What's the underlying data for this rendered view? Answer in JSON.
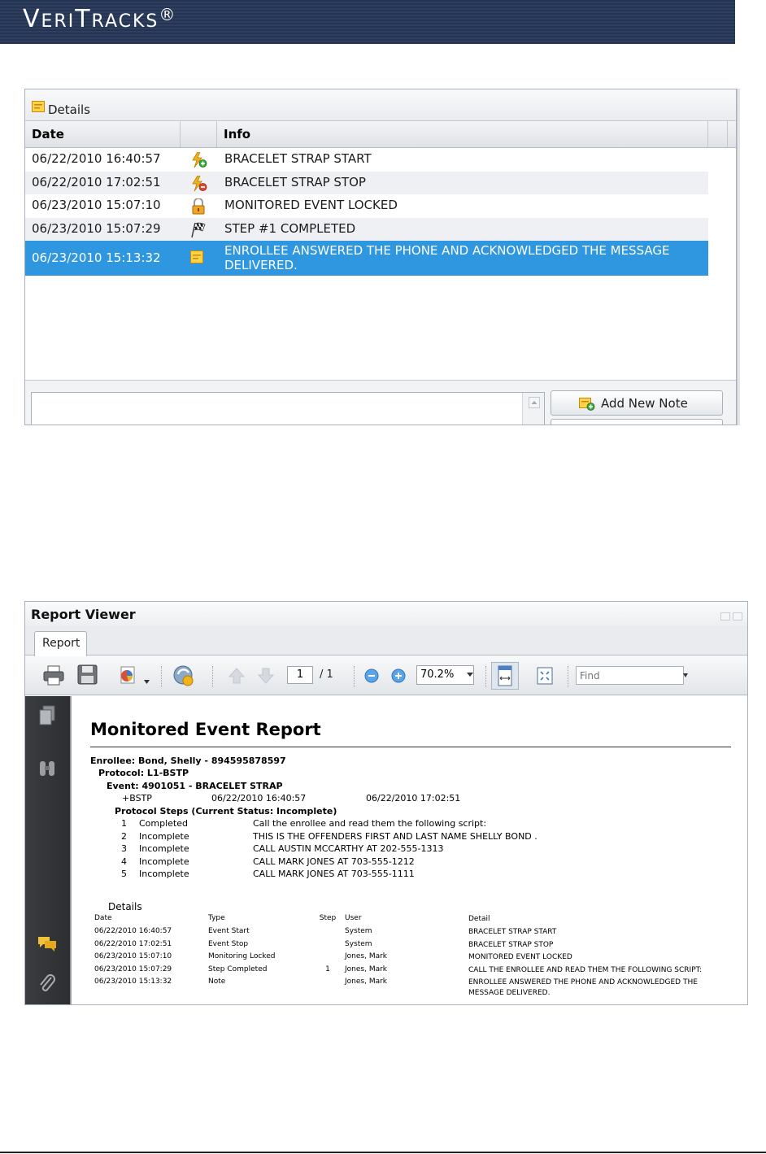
{
  "logo": {
    "text_big1": "V",
    "text_small1": "ERI",
    "text_big2": "T",
    "text_small2": "RACKS",
    "reg": "®"
  },
  "details_panel": {
    "title": "Details",
    "columns": {
      "date": "Date",
      "icon": "",
      "info": "Info"
    },
    "rows": [
      {
        "date": "06/22/2010 16:40:57",
        "icon": "bracelet-strap-start-icon",
        "info": "BRACELET STRAP START"
      },
      {
        "date": "06/22/2010 17:02:51",
        "icon": "bracelet-strap-stop-icon",
        "info": "BRACELET STRAP STOP"
      },
      {
        "date": "06/23/2010 15:07:10",
        "icon": "lock-icon",
        "info": "MONITORED EVENT LOCKED"
      },
      {
        "date": "06/23/2010 15:07:29",
        "icon": "checkered-flag-icon",
        "info": "STEP #1 COMPLETED"
      },
      {
        "date": "06/23/2010 15:13:32",
        "icon": "note-icon",
        "info": "ENROLLEE ANSWERED THE PHONE AND ACKNOWLEDGED THE MESSAGE DELIVERED.",
        "selected": true
      }
    ],
    "add_note_button": "Add New Note",
    "selected_color": "#2f97e0"
  },
  "report_viewer": {
    "title": "Report Viewer",
    "tab": "Report",
    "toolbar": {
      "page_current": "1",
      "page_total": "/ 1",
      "zoom": "70.2%",
      "find_placeholder": "Find"
    },
    "report": {
      "title": "Monitored Event Report",
      "enrollee": "Enrollee: Bond, Shelly - 894595878597",
      "protocol": "Protocol: L1-BSTP",
      "event": "Event: 4901051 - BRACELET STRAP",
      "event_code": "+BSTP",
      "event_start": "06/22/2010  16:40:57",
      "event_end": "06/22/2010  17:02:51",
      "steps_header": "Protocol Steps (Current Status: Incomplete)",
      "steps": [
        {
          "n": "1",
          "status": "Completed",
          "text": "Call the enrollee and read them the following script:"
        },
        {
          "n": "2",
          "status": "Incomplete",
          "text": "THIS IS THE OFFENDERS FIRST AND LAST NAME SHELLY BOND ."
        },
        {
          "n": "3",
          "status": "Incomplete",
          "text": "CALL AUSTIN MCCARTHY AT 202-555-1313"
        },
        {
          "n": "4",
          "status": "Incomplete",
          "text": "CALL MARK JONES AT 703-555-1212"
        },
        {
          "n": "5",
          "status": "Incomplete",
          "text": "CALL MARK JONES AT 703-555-1111"
        }
      ],
      "details_label": "Details",
      "details_columns": {
        "date": "Date",
        "type": "Type",
        "step": "Step",
        "user": "User",
        "detail": "Detail"
      },
      "details_rows": [
        {
          "date": "06/22/2010  16:40:57",
          "type": "Event Start",
          "step": "",
          "user": "System",
          "detail": "BRACELET STRAP START"
        },
        {
          "date": "06/22/2010  17:02:51",
          "type": "Event Stop",
          "step": "",
          "user": "System",
          "detail": "BRACELET STRAP STOP"
        },
        {
          "date": "06/23/2010  15:07:10",
          "type": "Monitoring Locked",
          "step": "",
          "user": "Jones, Mark",
          "detail": "MONITORED EVENT LOCKED"
        },
        {
          "date": "06/23/2010  15:07:29",
          "type": "Step Completed",
          "step": "1",
          "user": "Jones, Mark",
          "detail": "CALL THE ENROLLEE AND READ THEM THE FOLLOWING SCRIPT:"
        },
        {
          "date": "06/23/2010  15:13:32",
          "type": "Note",
          "step": "",
          "user": "Jones, Mark",
          "detail": "ENROLLEE ANSWERED THE PHONE AND ACKNOWLEDGED THE MESSAGE DELIVERED."
        }
      ]
    }
  }
}
